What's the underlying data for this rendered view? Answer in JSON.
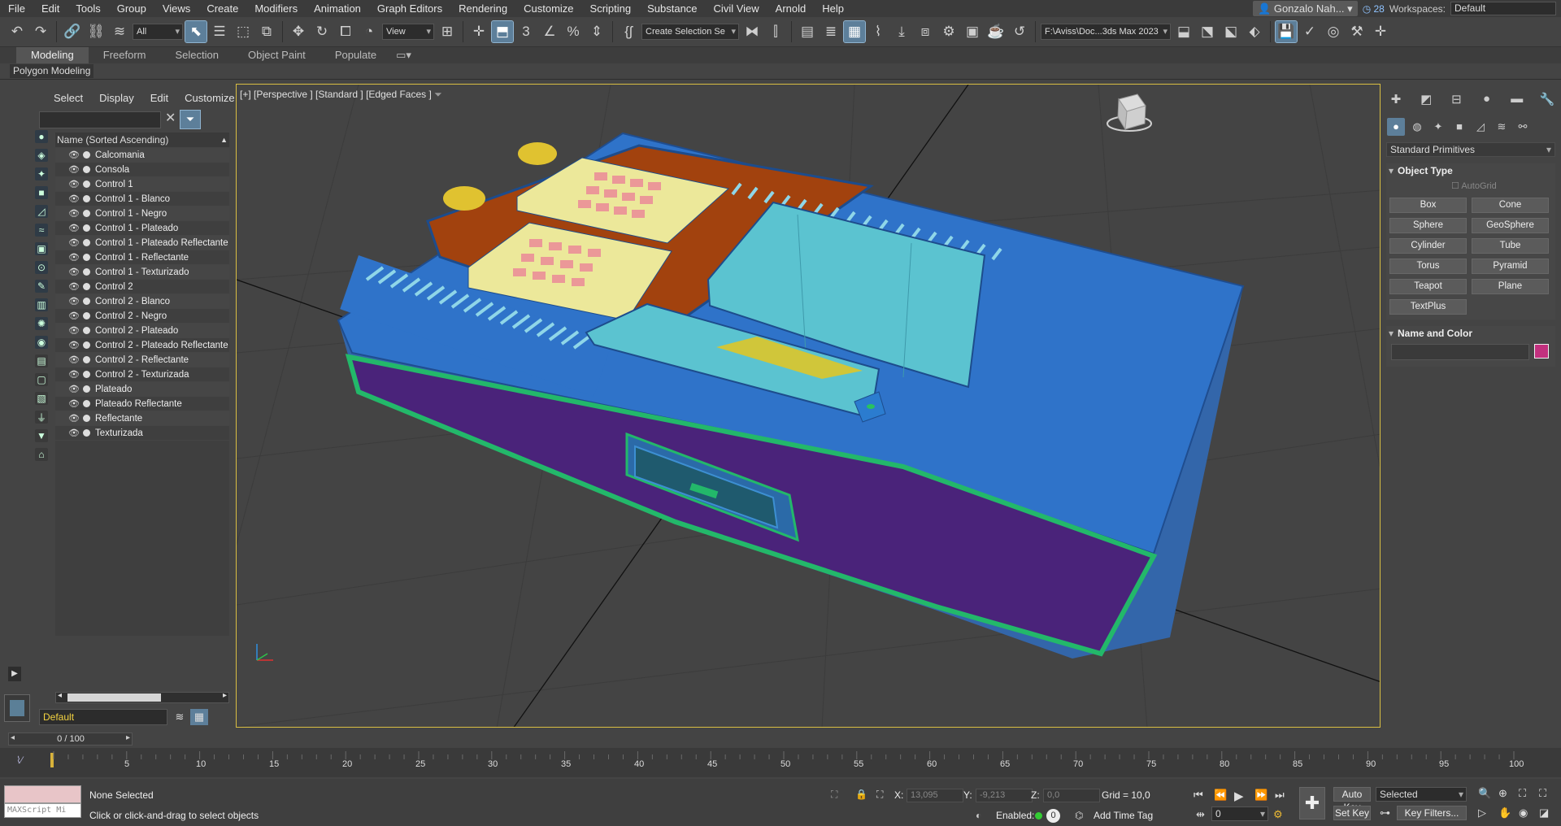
{
  "menu": [
    "File",
    "Edit",
    "Tools",
    "Group",
    "Views",
    "Create",
    "Modifiers",
    "Animation",
    "Graph Editors",
    "Rendering",
    "Customize",
    "Scripting",
    "Substance",
    "Civil View",
    "Arnold",
    "Help"
  ],
  "user": "Gonzalo Nah...",
  "notif_count": "28",
  "workspaces_label": "Workspaces:",
  "workspace_value": "Default",
  "toolbar": {
    "filter_value": "All",
    "ref_coord": "View",
    "named_sel": "Create Selection Se",
    "project_path": "F:\\Aviss\\Doc...3ds Max 2023"
  },
  "ribbon_tabs": [
    "Modeling",
    "Freeform",
    "Selection",
    "Object Paint",
    "Populate"
  ],
  "polygon_modeling": "Polygon Modeling",
  "scene_explorer": {
    "menu": [
      "Select",
      "Display",
      "Edit",
      "Customize"
    ],
    "column_header": "Name (Sorted Ascending)",
    "items": [
      "Calcomania",
      "Consola",
      "Control 1",
      "Control 1 - Blanco",
      "Control 1 - Negro",
      "Control 1 - Plateado",
      "Control 1 - Plateado Reflectante",
      "Control 1 - Reflectante",
      "Control 1 - Texturizado",
      "Control 2",
      "Control 2 - Blanco",
      "Control 2 - Negro",
      "Control 2 - Plateado",
      "Control 2 - Plateado Reflectante",
      "Control 2 - Reflectante",
      "Control 2 - Texturizada",
      "Plateado",
      "Plateado Reflectante",
      "Reflectante",
      "Texturizada"
    ],
    "layer": "Default"
  },
  "viewport_label": "[+] [Perspective ] [Standard ] [Edged Faces ]",
  "command_panel": {
    "category": "Standard Primitives",
    "object_type_title": "Object Type",
    "autogrid": "AutoGrid",
    "buttons": [
      "Box",
      "Cone",
      "Sphere",
      "GeoSphere",
      "Cylinder",
      "Tube",
      "Torus",
      "Pyramid",
      "Teapot",
      "Plane",
      "TextPlus"
    ],
    "name_color_title": "Name and Color",
    "swatch_color": "#c2307e"
  },
  "time": {
    "frame": "0 / 100",
    "ticks": [
      "5",
      "10",
      "15",
      "20",
      "25",
      "30",
      "35",
      "40",
      "45",
      "50",
      "55",
      "60",
      "65",
      "70",
      "75",
      "80",
      "85",
      "90",
      "95",
      "100"
    ]
  },
  "status": {
    "maxscript": "MAXScript Mi",
    "selection": "None Selected",
    "prompt": "Click or click-and-drag to select objects",
    "x_label": "X:",
    "x": "13,095",
    "y_label": "Y:",
    "y": "-9,213",
    "z_label": "Z:",
    "z": "0,0",
    "grid": "Grid = 10,0",
    "enabled": "Enabled:",
    "enabled_count": "0",
    "add_time_tag": "Add Time Tag",
    "auto_key": "Auto Key",
    "set_key": "Set Key",
    "key_mode": "Selected",
    "key_filters": "Key Filters...",
    "frame_field": "0"
  }
}
